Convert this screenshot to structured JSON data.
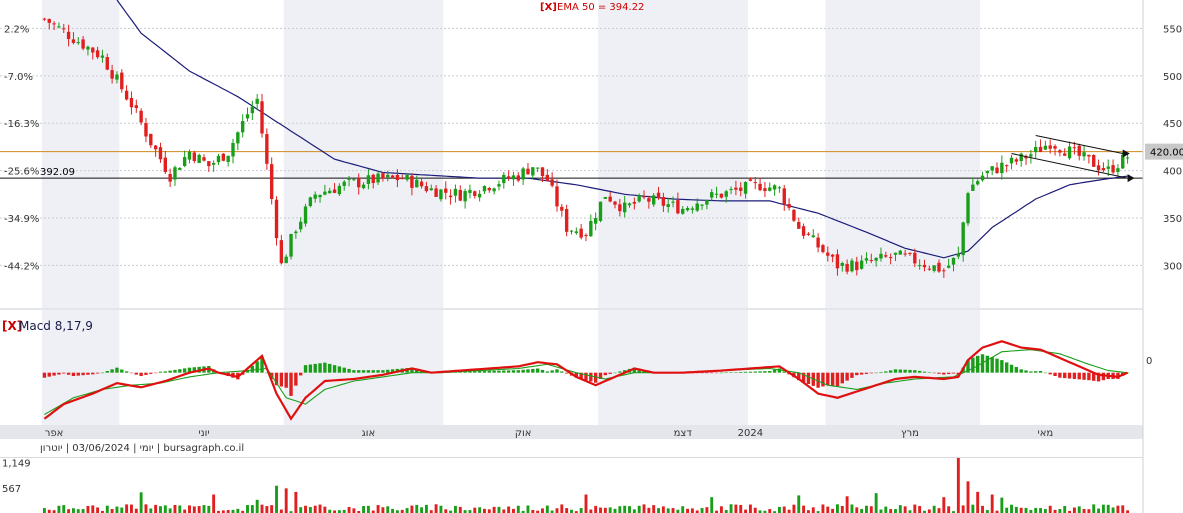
{
  "header": {
    "ema_close_mark": "[X]",
    "ema_label": "EMA 50 = 394.22"
  },
  "macd_panel": {
    "close_mark": "[X]",
    "label": "Macd 8,17,9",
    "zero_label": "0"
  },
  "footer": {
    "info": "יומי | 03/06/2024 | יוטרון | bursagraph.co.il"
  },
  "colors": {
    "up": "#1a9e1a",
    "down": "#e02020",
    "ema": "#1c1c7a",
    "macd": "#e01010",
    "signal": "#1a9e1a",
    "orange_line": "#d08a1a",
    "shade": "#eef0f5",
    "axis_band": "#e4e6ec"
  },
  "chart_data": [
    {
      "type": "candlestick",
      "title": "",
      "y_right_ticks": [
        300,
        350,
        400,
        450,
        500,
        550
      ],
      "y_left_ticks": [
        "2.2%",
        "-7.0%",
        "-16.3%",
        "-25.6%",
        "-34.9%",
        "-44.2%"
      ],
      "ylim": [
        255,
        580
      ],
      "x_month_labels": [
        "אפר",
        "יוני",
        "אוג",
        "אוק",
        "דצמ",
        "2024",
        "מרץ",
        "מאי"
      ],
      "x_month_positions": [
        2,
        33,
        67,
        99,
        132,
        146,
        179,
        207
      ],
      "n_bars": 225,
      "close_anchors": [
        [
          0,
          560
        ],
        [
          6,
          540
        ],
        [
          12,
          520
        ],
        [
          18,
          470
        ],
        [
          22,
          430
        ],
        [
          26,
          395
        ],
        [
          30,
          420
        ],
        [
          34,
          405
        ],
        [
          38,
          420
        ],
        [
          42,
          460
        ],
        [
          44,
          475
        ],
        [
          47,
          370
        ],
        [
          49,
          300
        ],
        [
          52,
          340
        ],
        [
          56,
          375
        ],
        [
          62,
          385
        ],
        [
          68,
          390
        ],
        [
          74,
          392
        ],
        [
          80,
          380
        ],
        [
          86,
          375
        ],
        [
          92,
          385
        ],
        [
          98,
          395
        ],
        [
          101,
          405
        ],
        [
          104,
          390
        ],
        [
          108,
          340
        ],
        [
          112,
          335
        ],
        [
          116,
          375
        ],
        [
          120,
          360
        ],
        [
          124,
          370
        ],
        [
          128,
          365
        ],
        [
          132,
          360
        ],
        [
          136,
          370
        ],
        [
          140,
          375
        ],
        [
          144,
          380
        ],
        [
          148,
          385
        ],
        [
          152,
          380
        ],
        [
          156,
          340
        ],
        [
          160,
          320
        ],
        [
          164,
          300
        ],
        [
          168,
          300
        ],
        [
          172,
          305
        ],
        [
          176,
          310
        ],
        [
          180,
          305
        ],
        [
          186,
          295
        ],
        [
          189,
          310
        ],
        [
          191,
          380
        ],
        [
          194,
          395
        ],
        [
          198,
          405
        ],
        [
          201,
          410
        ],
        [
          205,
          420
        ],
        [
          208,
          430
        ],
        [
          212,
          420
        ],
        [
          216,
          410
        ],
        [
          220,
          400
        ],
        [
          224,
          415
        ]
      ],
      "ema50_anchors": [
        [
          15,
          580
        ],
        [
          20,
          545
        ],
        [
          30,
          505
        ],
        [
          40,
          478
        ],
        [
          50,
          445
        ],
        [
          60,
          412
        ],
        [
          70,
          398
        ],
        [
          80,
          395
        ],
        [
          90,
          392
        ],
        [
          100,
          392
        ],
        [
          110,
          385
        ],
        [
          120,
          375
        ],
        [
          130,
          370
        ],
        [
          140,
          368
        ],
        [
          150,
          368
        ],
        [
          160,
          355
        ],
        [
          170,
          335
        ],
        [
          178,
          318
        ],
        [
          186,
          308
        ],
        [
          191,
          315
        ],
        [
          196,
          340
        ],
        [
          205,
          370
        ],
        [
          212,
          385
        ],
        [
          218,
          390
        ],
        [
          224,
          394.22
        ]
      ],
      "horizontal_lines": [
        {
          "value": 420.0,
          "label": "420.00"
        },
        {
          "value": 392.09,
          "label": "392.09"
        }
      ],
      "channel": {
        "upper": [
          [
            205,
            437
          ],
          [
            223,
            418
          ]
        ],
        "lower": [
          [
            200,
            418
          ],
          [
            224,
            392
          ]
        ]
      }
    },
    {
      "type": "line",
      "name_series": [
        "MACD",
        "Signal",
        "Histogram"
      ],
      "ylim": [
        -25,
        18
      ],
      "macd_anchors": [
        [
          0,
          -22
        ],
        [
          4,
          -15
        ],
        [
          10,
          -10
        ],
        [
          15,
          -5
        ],
        [
          20,
          -7
        ],
        [
          25,
          -4
        ],
        [
          30,
          0
        ],
        [
          34,
          2
        ],
        [
          36,
          0
        ],
        [
          40,
          -2
        ],
        [
          43,
          4
        ],
        [
          45,
          8
        ],
        [
          48,
          -10
        ],
        [
          51,
          -22
        ],
        [
          54,
          -12
        ],
        [
          58,
          -4
        ],
        [
          64,
          -3
        ],
        [
          70,
          -1
        ],
        [
          76,
          2
        ],
        [
          80,
          0
        ],
        [
          86,
          1
        ],
        [
          92,
          2
        ],
        [
          98,
          3
        ],
        [
          102,
          5
        ],
        [
          106,
          4
        ],
        [
          110,
          -2
        ],
        [
          114,
          -6
        ],
        [
          118,
          -2
        ],
        [
          122,
          2
        ],
        [
          126,
          0
        ],
        [
          132,
          0
        ],
        [
          140,
          1
        ],
        [
          146,
          2
        ],
        [
          152,
          3
        ],
        [
          156,
          -3
        ],
        [
          160,
          -10
        ],
        [
          164,
          -12
        ],
        [
          168,
          -9
        ],
        [
          172,
          -6
        ],
        [
          176,
          -3
        ],
        [
          180,
          -2
        ],
        [
          186,
          -3
        ],
        [
          189,
          -2
        ],
        [
          191,
          6
        ],
        [
          194,
          12
        ],
        [
          198,
          15
        ],
        [
          202,
          12
        ],
        [
          206,
          11
        ],
        [
          210,
          7
        ],
        [
          214,
          3
        ],
        [
          218,
          -1
        ],
        [
          222,
          -2
        ],
        [
          224,
          0
        ]
      ],
      "signal_anchors": [
        [
          0,
          -20
        ],
        [
          6,
          -12
        ],
        [
          12,
          -8
        ],
        [
          18,
          -6
        ],
        [
          24,
          -5
        ],
        [
          30,
          -2
        ],
        [
          36,
          0
        ],
        [
          42,
          1
        ],
        [
          46,
          2
        ],
        [
          50,
          -12
        ],
        [
          54,
          -15
        ],
        [
          58,
          -8
        ],
        [
          64,
          -4
        ],
        [
          70,
          -2
        ],
        [
          76,
          0
        ],
        [
          82,
          0
        ],
        [
          90,
          1
        ],
        [
          98,
          2
        ],
        [
          104,
          4
        ],
        [
          110,
          0
        ],
        [
          116,
          -3
        ],
        [
          122,
          0
        ],
        [
          130,
          0
        ],
        [
          140,
          1
        ],
        [
          150,
          2
        ],
        [
          156,
          0
        ],
        [
          162,
          -6
        ],
        [
          168,
          -8
        ],
        [
          174,
          -5
        ],
        [
          180,
          -3
        ],
        [
          188,
          -2
        ],
        [
          192,
          2
        ],
        [
          198,
          10
        ],
        [
          204,
          11
        ],
        [
          210,
          9
        ],
        [
          216,
          4
        ],
        [
          220,
          1
        ],
        [
          224,
          0
        ]
      ]
    },
    {
      "type": "bar",
      "name": "Volume",
      "y_ticks": [
        567,
        1149
      ],
      "ylim": [
        0,
        1250
      ],
      "spikes": [
        [
          20,
          470
        ],
        [
          35,
          420
        ],
        [
          44,
          300
        ],
        [
          48,
          620
        ],
        [
          50,
          560
        ],
        [
          52,
          480
        ],
        [
          112,
          420
        ],
        [
          138,
          360
        ],
        [
          156,
          400
        ],
        [
          166,
          380
        ],
        [
          172,
          450
        ],
        [
          186,
          360
        ],
        [
          189,
          1250
        ],
        [
          191,
          720
        ],
        [
          193,
          480
        ],
        [
          196,
          420
        ],
        [
          198,
          350
        ]
      ]
    }
  ]
}
